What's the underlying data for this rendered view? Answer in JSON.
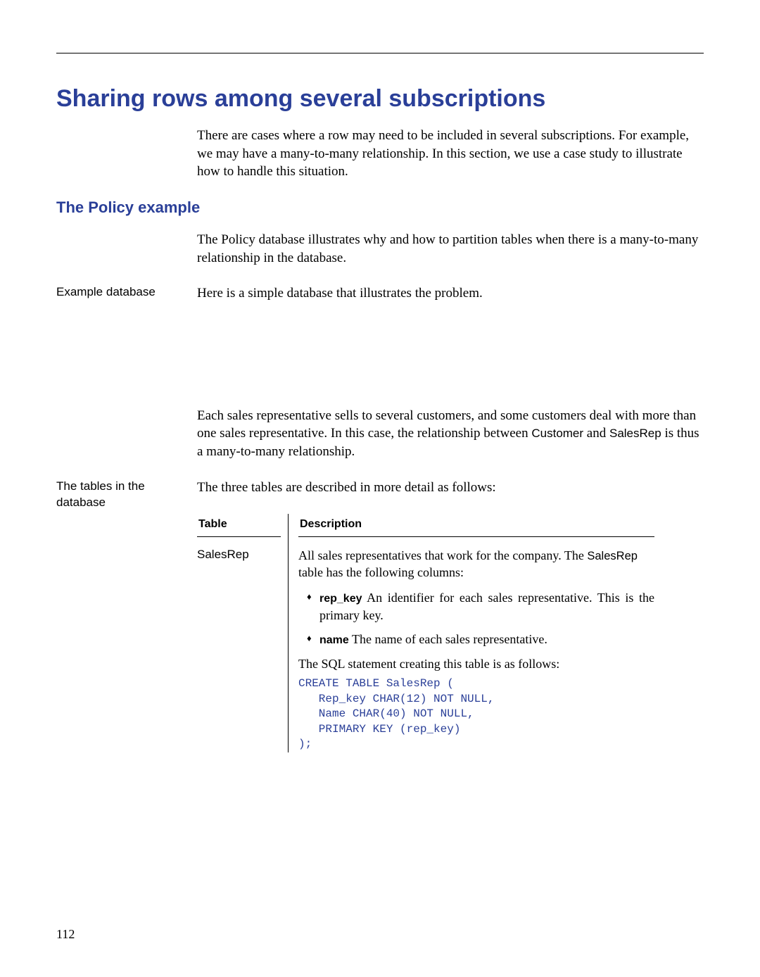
{
  "heading": "Sharing rows among several subscriptions",
  "intro": "There are cases where a row may need to be included in several subscriptions. For example, we may have a many-to-many relationship. In this section, we use a case study to illustrate how to handle this situation.",
  "subheading": "The Policy example",
  "policy_intro": "The Policy database illustrates why and how to partition tables when there is a many-to-many relationship in the database.",
  "example_db_label": "Example database",
  "example_db_text": "Here is a simple database that illustrates the problem.",
  "each_rep_pre": "Each sales representative sells to several customers, and some customers deal with more than one sales representative. In this case, the relationship between ",
  "customer_word": "Customer",
  "and_word": " and ",
  "salesrep_word": "SalesRep",
  "each_rep_post": " is thus a many-to-many relationship.",
  "tables_label": "The tables in the database",
  "tables_intro": "The three tables are described in more detail as follows:",
  "th_table": "Table",
  "th_desc": "Description",
  "row1_name": "SalesRep",
  "row1_intro_pre": "All sales representatives that work for the company. The ",
  "row1_intro_code": "SalesRep",
  "row1_intro_post": " table has the following columns:",
  "col_repkey": "rep_key",
  "col_repkey_text": "   An identifier for each sales representative. This is the primary key.",
  "col_name": "name",
  "col_name_text": "   The name of each sales representative.",
  "sql_intro": "The SQL statement creating this table is as follows:",
  "sql_code": "CREATE TABLE SalesRep (\n   Rep_key CHAR(12) NOT NULL,\n   Name CHAR(40) NOT NULL,\n   PRIMARY KEY (rep_key)\n);",
  "page_number": "112"
}
